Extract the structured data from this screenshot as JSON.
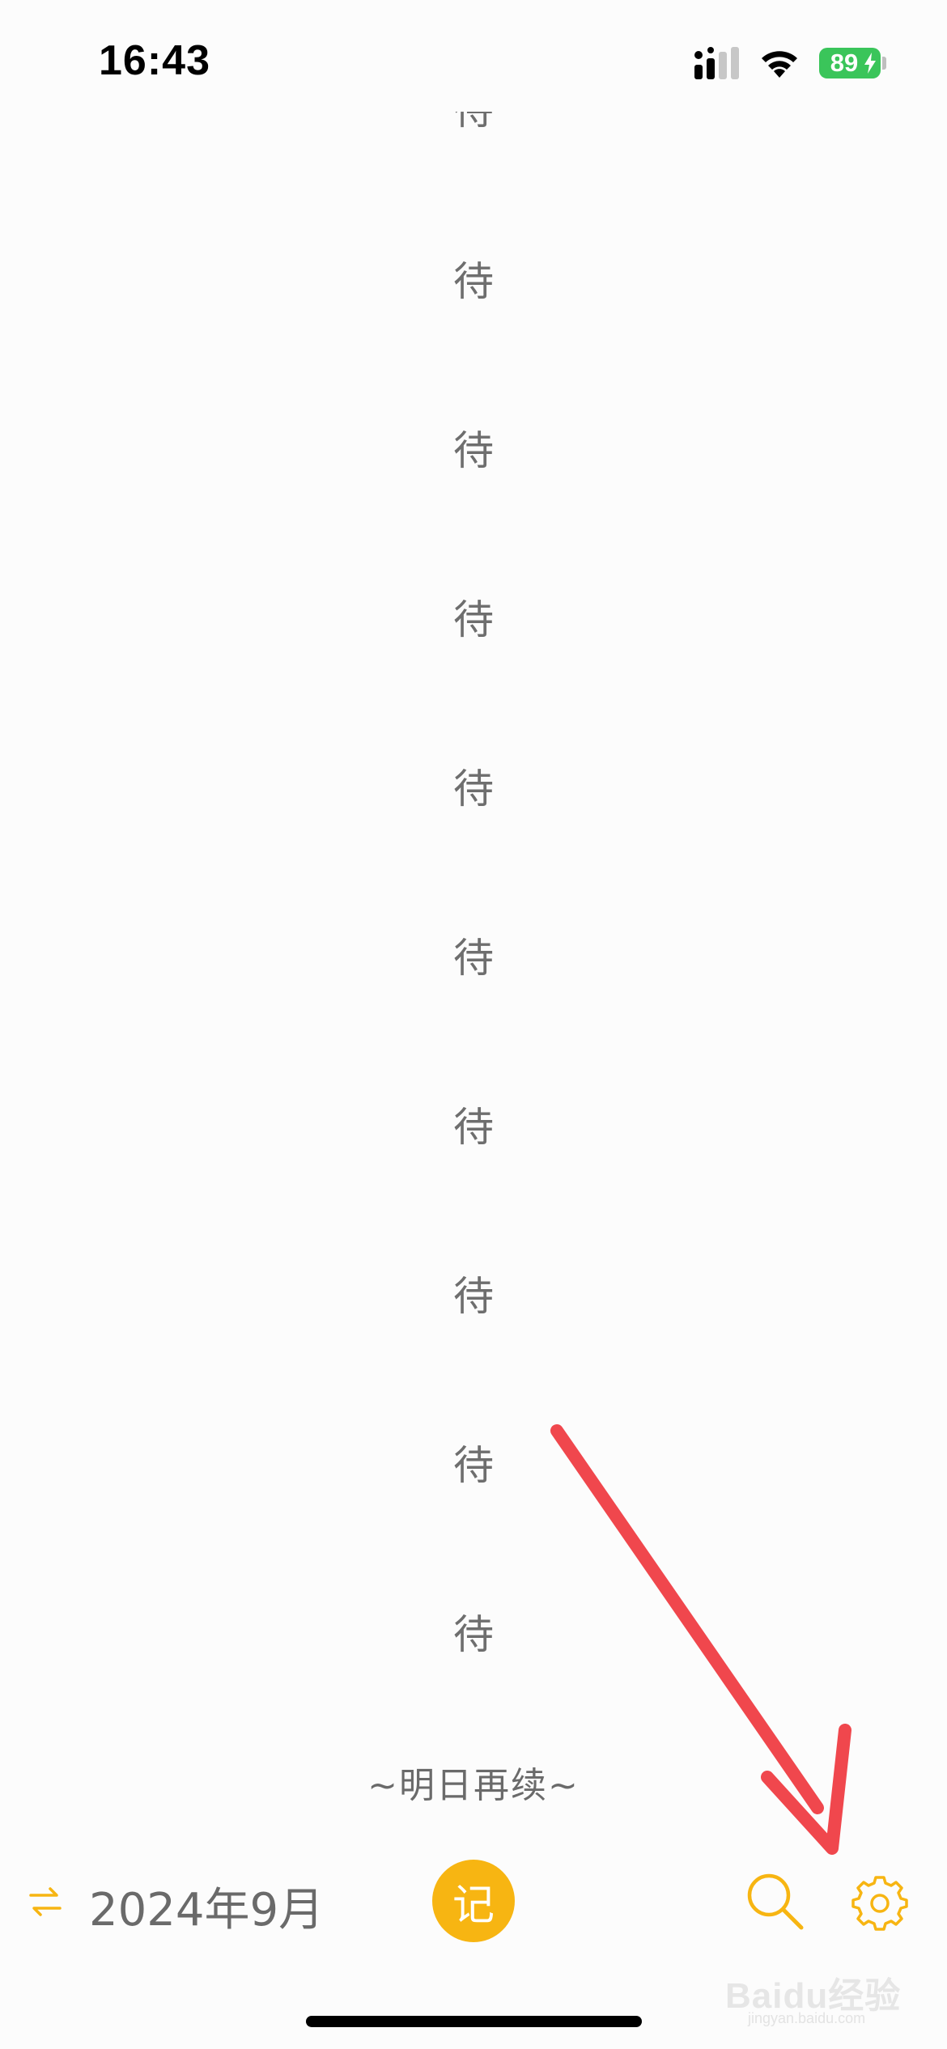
{
  "status_bar": {
    "time": "16:43",
    "battery": "89"
  },
  "list": {
    "partial_item": "待",
    "items": [
      "待",
      "待",
      "待",
      "待",
      "待",
      "待",
      "待",
      "待",
      "待"
    ]
  },
  "footer_note": "~明日再续~",
  "toolbar": {
    "month": "2024年9月",
    "note_button": "记",
    "icons": [
      "swap-icon",
      "search-icon",
      "gear-icon"
    ]
  },
  "watermark": {
    "text": "Baidu经验",
    "sub": "jingyan.baidu.com"
  },
  "colors": {
    "accent": "#f7b512",
    "text": "#6e6e6e",
    "battery": "#3ac55a",
    "annotation": "#f0474d",
    "background": "#fcfcfc"
  }
}
